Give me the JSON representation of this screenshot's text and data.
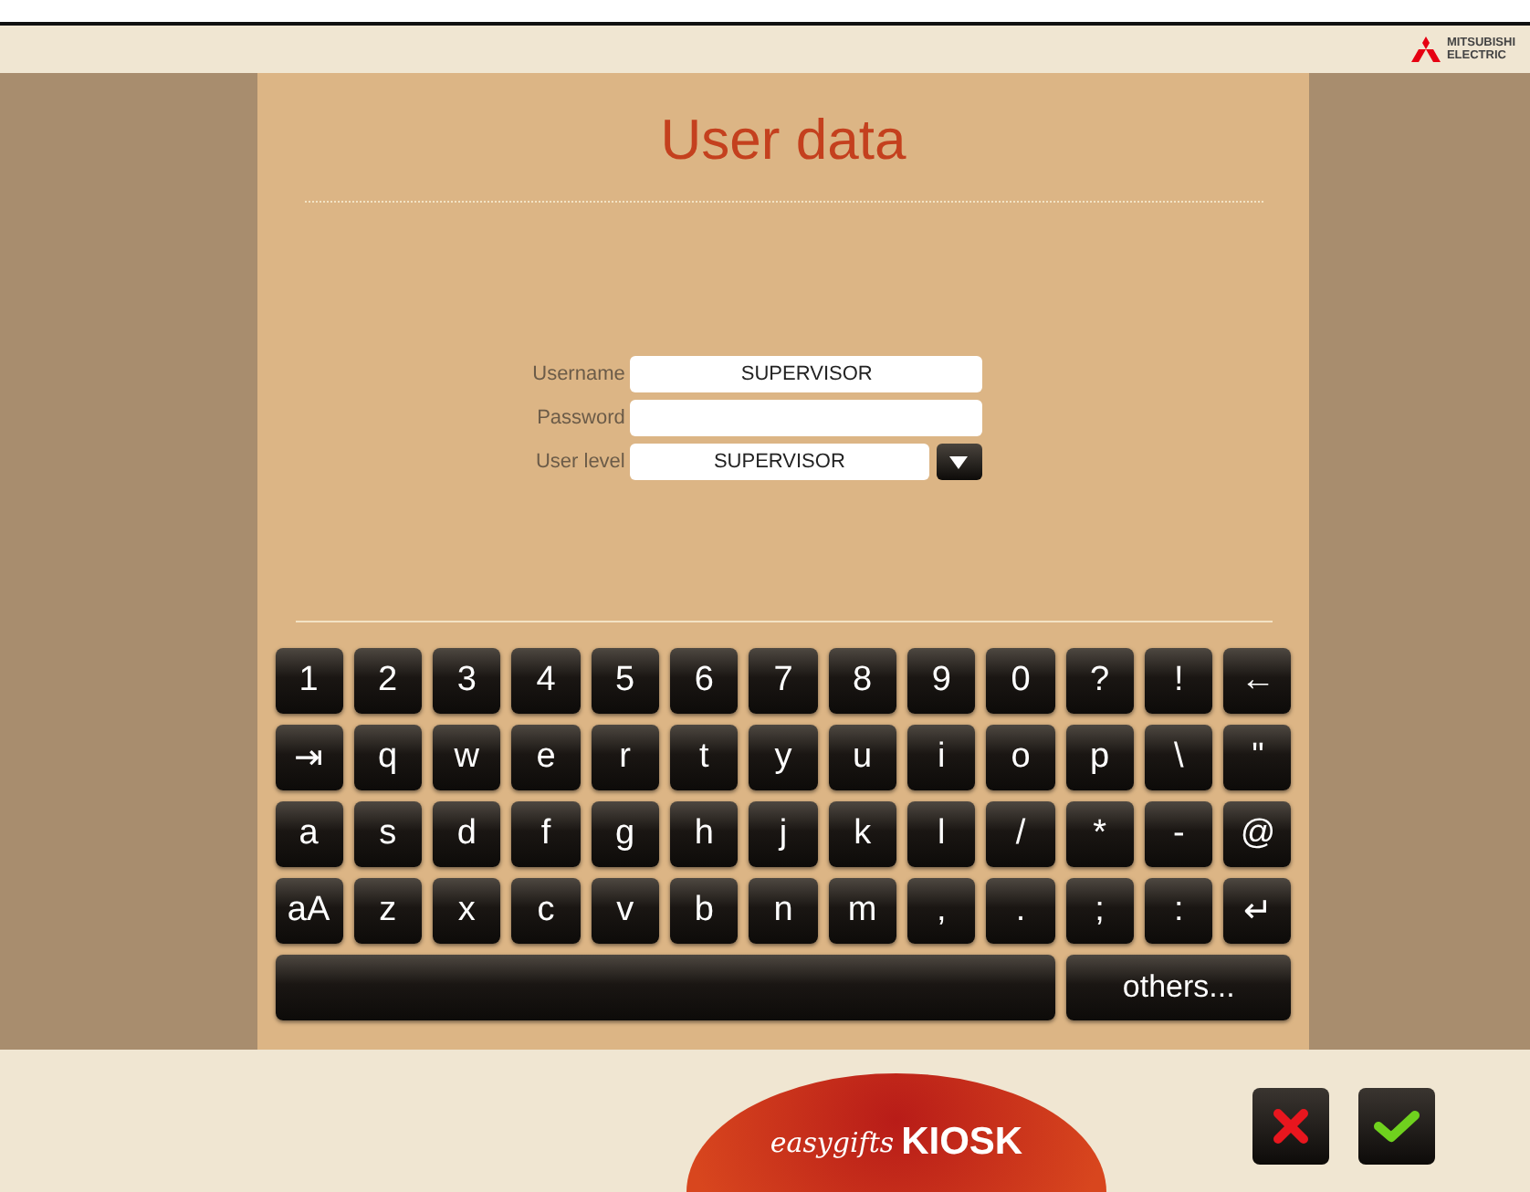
{
  "brand": {
    "line_1": "MITSUBISHI",
    "line_2": "ELECTRIC"
  },
  "title": "User data",
  "form": [
    {
      "label": "Username",
      "value": "SUPERVISOR",
      "kind": "text"
    },
    {
      "label": "Password",
      "kind": "text"
    },
    {
      "label": "User level",
      "value": "SUPERVISOR",
      "kind": "dropdown"
    }
  ],
  "keyboard": [
    [
      {
        "label": "1"
      },
      {
        "label": "2"
      },
      {
        "label": "3"
      },
      {
        "label": "4"
      },
      {
        "label": "5"
      },
      {
        "label": "6"
      },
      {
        "label": "7"
      },
      {
        "label": "8"
      },
      {
        "label": "9"
      },
      {
        "label": "0"
      },
      {
        "label": "?"
      },
      {
        "label": "!"
      },
      {
        "label": "←"
      }
    ],
    [
      {
        "label": "⇥"
      },
      {
        "label": "q"
      },
      {
        "label": "w"
      },
      {
        "label": "e"
      },
      {
        "label": "r"
      },
      {
        "label": "t"
      },
      {
        "label": "y"
      },
      {
        "label": "u"
      },
      {
        "label": "i"
      },
      {
        "label": "o"
      },
      {
        "label": "p"
      },
      {
        "label": "\\"
      },
      {
        "label": "\""
      }
    ],
    [
      {
        "label": "a"
      },
      {
        "label": "s"
      },
      {
        "label": "d"
      },
      {
        "label": "f"
      },
      {
        "label": "g"
      },
      {
        "label": "h"
      },
      {
        "label": "j"
      },
      {
        "label": "k"
      },
      {
        "label": "l"
      },
      {
        "label": "/"
      },
      {
        "label": "*"
      },
      {
        "label": "-"
      },
      {
        "label": "@"
      }
    ],
    [
      {
        "label": "aA"
      },
      {
        "label": "z"
      },
      {
        "label": "x"
      },
      {
        "label": "c"
      },
      {
        "label": "v"
      },
      {
        "label": "b"
      },
      {
        "label": "n"
      },
      {
        "label": "m"
      },
      {
        "label": ","
      },
      {
        "label": "."
      },
      {
        "label": ";"
      },
      {
        "label": ":"
      },
      {
        "label": "↵"
      }
    ],
    [
      {
        "kind": "space"
      },
      {
        "kind": "wide",
        "label": "others..."
      }
    ]
  ],
  "logo": {
    "line_1": "easygifts",
    "line_2": "KIOSK"
  },
  "actions": [
    {
      "kind": "cancel"
    },
    {
      "kind": "confirm"
    }
  ]
}
